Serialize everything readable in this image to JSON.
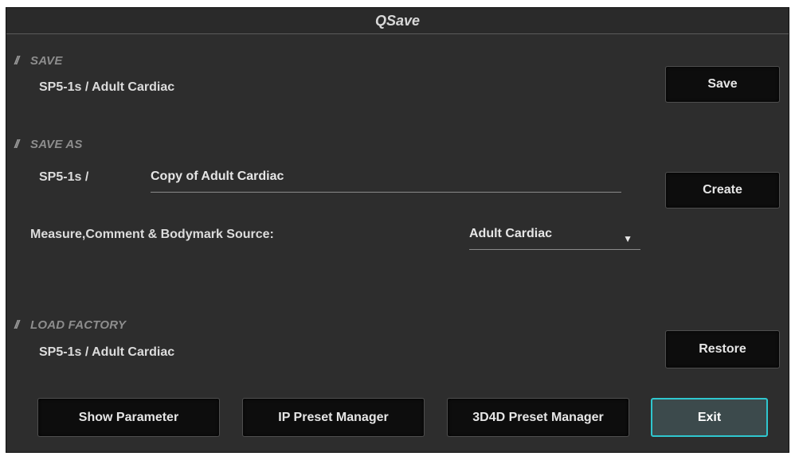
{
  "window": {
    "title": "QSave"
  },
  "save": {
    "heading": "SAVE",
    "preset_path": "SP5-1s  /  Adult Cardiac",
    "button_label": "Save"
  },
  "save_as": {
    "heading": "SAVE AS",
    "probe_prefix": "SP5-1s  /",
    "name_value": "Copy of Adult Cardiac",
    "button_label": "Create",
    "source_label": "Measure,Comment & Bodymark Source:",
    "source_value": "Adult Cardiac"
  },
  "load_factory": {
    "heading": "LOAD FACTORY",
    "preset_path": "SP5-1s  /  Adult Cardiac",
    "button_label": "Restore"
  },
  "footer": {
    "show_parameter": "Show Parameter",
    "ip_preset_manager": "IP Preset Manager",
    "preset_3d4d_manager": "3D4D Preset Manager",
    "exit": "Exit"
  },
  "colors": {
    "background": "#2d2d2d",
    "button_bg": "#0d0d0d",
    "exit_border": "#2fc7cf",
    "heading_text": "#8d8d8d",
    "body_text": "#dcdcdc"
  },
  "icons": {
    "section_marker": "double-slash-marker",
    "dropdown": "triangle-down-icon"
  }
}
